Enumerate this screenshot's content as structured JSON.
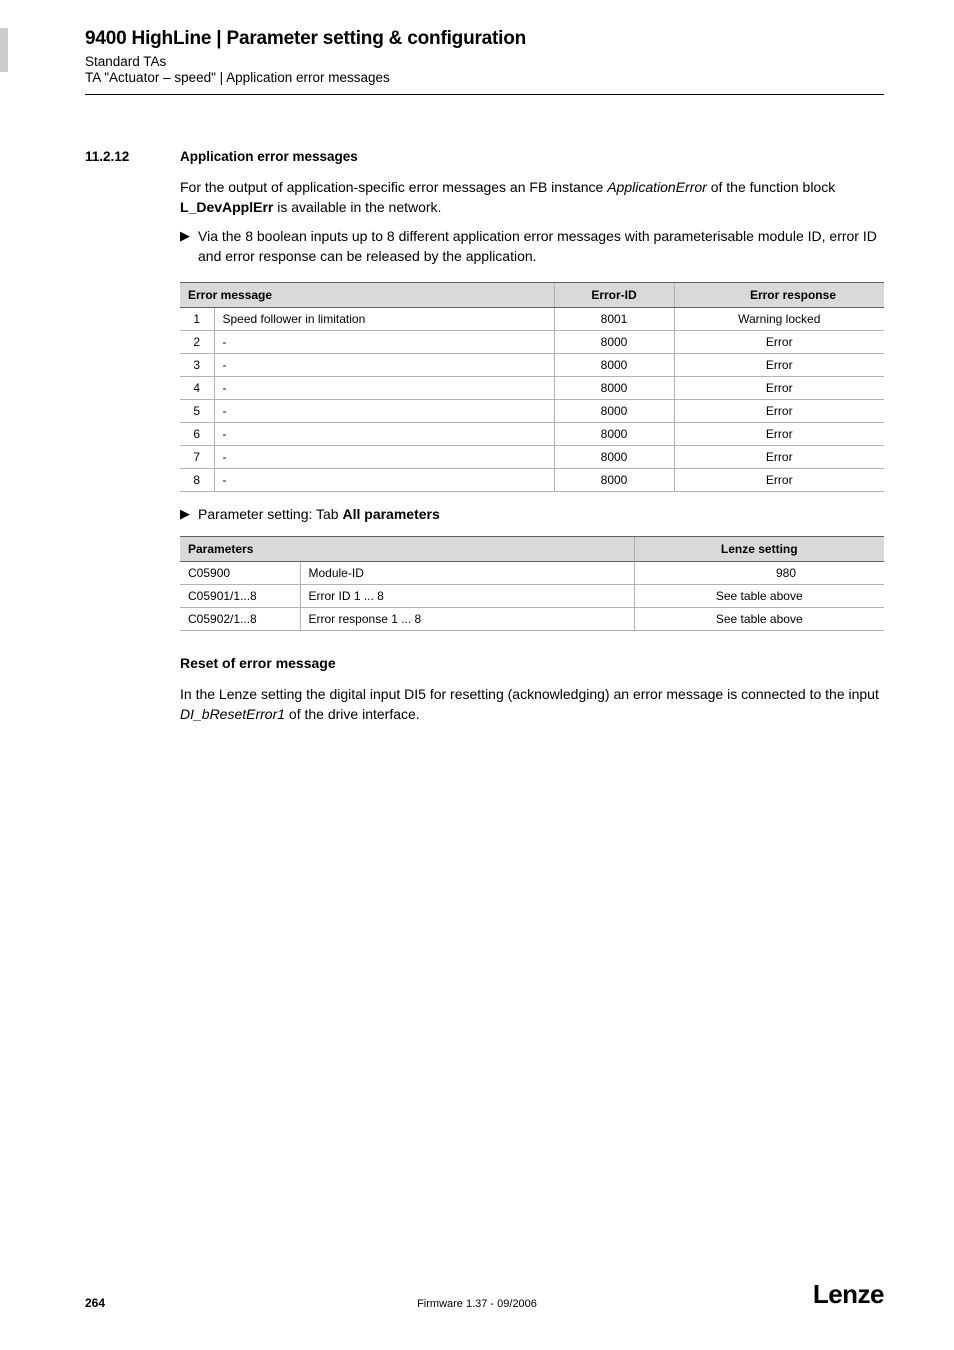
{
  "header": {
    "title": "9400 HighLine | Parameter setting & configuration",
    "sub1": "Standard TAs",
    "sub2": "TA \"Actuator – speed\" | Application error messages"
  },
  "section": {
    "num": "11.2.12",
    "title": "Application error messages"
  },
  "intro_para_pre": "For the output of application-specific error messages an FB instance ",
  "intro_para_italic": "ApplicationError",
  "intro_para_mid": " of the function block ",
  "intro_para_bold": "L_DevApplErr",
  "intro_para_post": " is available in the network.",
  "bullet1": "Via the 8 boolean inputs up to 8 different application error messages with parameterisable module ID, error ID and error response can be released by the application.",
  "err_table": {
    "headers": {
      "msg": "Error message",
      "id": "Error-ID",
      "resp": "Error response"
    },
    "rows": [
      {
        "n": "1",
        "msg": "Speed follower in limitation",
        "id": "8001",
        "resp": "Warning locked"
      },
      {
        "n": "2",
        "msg": "-",
        "id": "8000",
        "resp": "Error"
      },
      {
        "n": "3",
        "msg": "-",
        "id": "8000",
        "resp": "Error"
      },
      {
        "n": "4",
        "msg": "-",
        "id": "8000",
        "resp": "Error"
      },
      {
        "n": "5",
        "msg": "-",
        "id": "8000",
        "resp": "Error"
      },
      {
        "n": "6",
        "msg": "-",
        "id": "8000",
        "resp": "Error"
      },
      {
        "n": "7",
        "msg": "-",
        "id": "8000",
        "resp": "Error"
      },
      {
        "n": "8",
        "msg": "-",
        "id": "8000",
        "resp": "Error"
      }
    ]
  },
  "param_bullet_pre": "Parameter setting: Tab ",
  "param_bullet_bold": "All parameters",
  "param_table": {
    "headers": {
      "param": "Parameters",
      "lenze": "Lenze setting"
    },
    "rows": [
      {
        "code": "C05900",
        "desc": "Module-ID",
        "val": "980",
        "num": true
      },
      {
        "code": "C05901/1...8",
        "desc": "Error ID 1 ... 8",
        "val": "See table above",
        "num": false
      },
      {
        "code": "C05902/1...8",
        "desc": "Error response 1 ... 8",
        "val": "See table above",
        "num": false
      }
    ]
  },
  "reset": {
    "heading": "Reset of error message",
    "para_pre": "In the Lenze setting the digital input DI5 for resetting (acknowledging) an error message is connected to the input ",
    "para_italic": "DI_bResetError1",
    "para_post": " of the drive interface."
  },
  "footer": {
    "page": "264",
    "center": "Firmware 1.37 - 09/2006",
    "logo": "Lenze"
  }
}
